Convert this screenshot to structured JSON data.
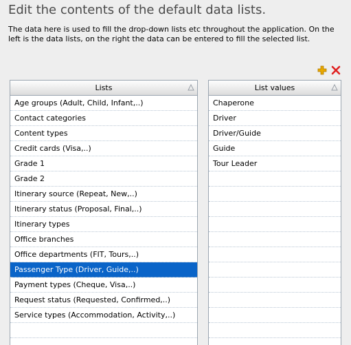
{
  "page": {
    "title": "Edit the contents of the default data lists.",
    "description": "The data here is used to fill the drop-down lists etc throughout the application. On the left is the data lists, on the right the data can be entered to fill the selected list."
  },
  "toolbar": {
    "add_icon": "plus-icon",
    "delete_icon": "close-icon",
    "add_color": "#e8a800",
    "delete_color": "#e02020"
  },
  "lists_grid": {
    "header": "Lists",
    "selected_index": 11,
    "items": [
      "Age groups (Adult, Child, Infant,..)",
      "Contact categories",
      "Content types",
      "Credit cards (Visa,..)",
      "Grade 1",
      "Grade 2",
      "Itinerary source (Repeat, New,..)",
      "Itinerary status (Proposal, Final,..)",
      "Itinerary types",
      "Office branches",
      "Office departments (FIT, Tours,..)",
      "Passenger Type (Driver, Guide,..)",
      "Payment types (Cheque, Visa,..)",
      "Request status (Requested, Confirmed,..)",
      "Service types (Accommodation, Activity,..)"
    ]
  },
  "values_grid": {
    "header": "List values",
    "items": [
      "Chaperone",
      "Driver",
      "Driver/Guide",
      "Guide",
      "Tour Leader"
    ]
  },
  "colors": {
    "selection": "#0a64c8",
    "grid_border": "#9aa5b0",
    "background": "#eeeeee"
  }
}
